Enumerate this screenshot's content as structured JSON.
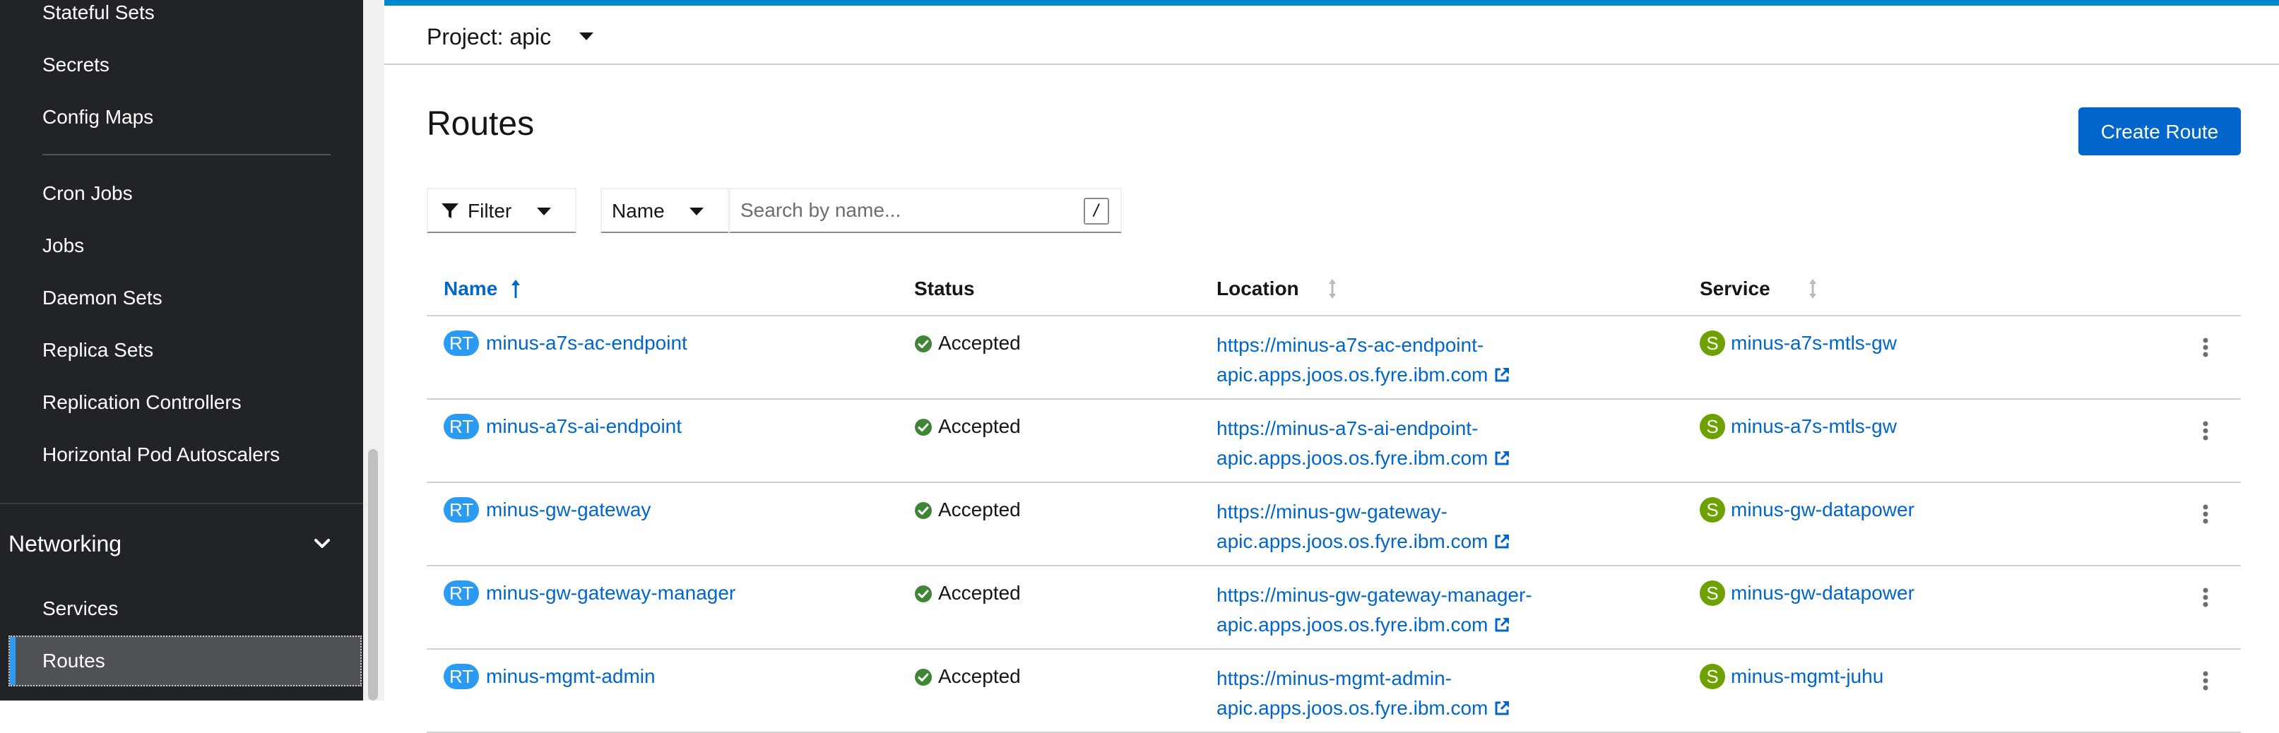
{
  "sidebar": {
    "items": [
      {
        "label": "Stateful Sets"
      },
      {
        "label": "Secrets"
      },
      {
        "label": "Config Maps"
      },
      {
        "label": "Cron Jobs"
      },
      {
        "label": "Jobs"
      },
      {
        "label": "Daemon Sets"
      },
      {
        "label": "Replica Sets"
      },
      {
        "label": "Replication Controllers"
      },
      {
        "label": "Horizontal Pod Autoscalers"
      }
    ],
    "section": {
      "label": "Networking",
      "icon": "chevron-down-icon"
    },
    "section_items": [
      {
        "label": "Services"
      },
      {
        "label": "Routes",
        "active": true
      }
    ]
  },
  "project": {
    "label": "Project: apic"
  },
  "page": {
    "title": "Routes"
  },
  "actions": {
    "create_label": "Create Route"
  },
  "toolbar": {
    "filter_label": "Filter",
    "filter_by": "Name",
    "search_placeholder": "Search by name...",
    "shortcut": "/"
  },
  "table": {
    "columns": [
      {
        "label": "Name",
        "sorted": "ascending"
      },
      {
        "label": "Status"
      },
      {
        "label": "Location"
      },
      {
        "label": "Service"
      }
    ],
    "rows": [
      {
        "badge": "RT",
        "name": "minus-a7s-ac-endpoint",
        "status": "Accepted",
        "location_line1": "https://minus-a7s-ac-endpoint-",
        "location_line2": "apic.apps.joos.os.fyre.ibm.com",
        "service_badge": "S",
        "service": "minus-a7s-mtls-gw"
      },
      {
        "badge": "RT",
        "name": "minus-a7s-ai-endpoint",
        "status": "Accepted",
        "location_line1": "https://minus-a7s-ai-endpoint-",
        "location_line2": "apic.apps.joos.os.fyre.ibm.com",
        "service_badge": "S",
        "service": "minus-a7s-mtls-gw"
      },
      {
        "badge": "RT",
        "name": "minus-gw-gateway",
        "status": "Accepted",
        "location_line1": "https://minus-gw-gateway-",
        "location_line2": "apic.apps.joos.os.fyre.ibm.com",
        "service_badge": "S",
        "service": "minus-gw-datapower"
      },
      {
        "badge": "RT",
        "name": "minus-gw-gateway-manager",
        "status": "Accepted",
        "location_line1": "https://minus-gw-gateway-manager-",
        "location_line2": "apic.apps.joos.os.fyre.ibm.com",
        "service_badge": "S",
        "service": "minus-gw-datapower"
      },
      {
        "badge": "RT",
        "name": "minus-mgmt-admin",
        "status": "Accepted",
        "location_line1": "https://minus-mgmt-admin-",
        "location_line2": "apic.apps.joos.os.fyre.ibm.com",
        "service_badge": "S",
        "service": "minus-mgmt-juhu"
      }
    ]
  },
  "colors": {
    "accent": "#0066cc",
    "route_badge": "#2b9af3",
    "service_badge": "#6ca100",
    "success": "#3e8635",
    "sidebar_bg": "#212427"
  }
}
